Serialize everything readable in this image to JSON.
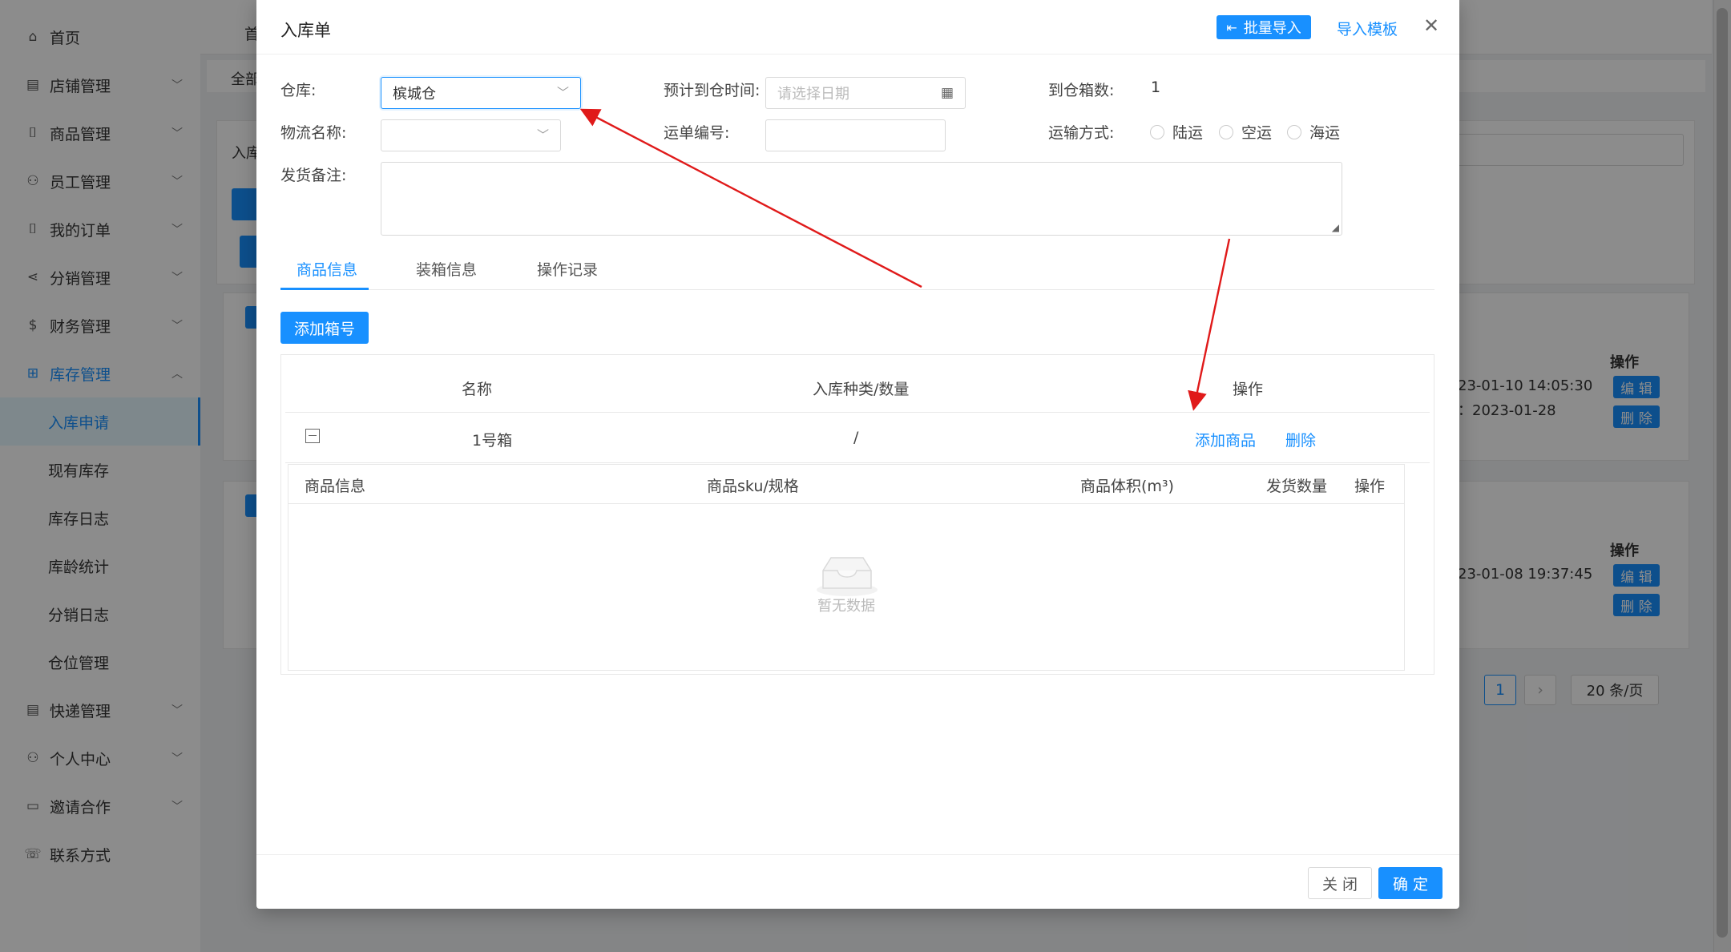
{
  "sidebar": {
    "items": [
      {
        "label": "首页",
        "icon": "home-icon",
        "glyph": "⌂",
        "chevron": false
      },
      {
        "label": "店铺管理",
        "icon": "shop-icon",
        "glyph": "▤",
        "chevron": true
      },
      {
        "label": "商品管理",
        "icon": "bag-icon",
        "glyph": "⌷",
        "chevron": true
      },
      {
        "label": "员工管理",
        "icon": "staff-icon",
        "glyph": "⚇",
        "chevron": true
      },
      {
        "label": "我的订单",
        "icon": "order-icon",
        "glyph": "⌷",
        "chevron": true
      },
      {
        "label": "分销管理",
        "icon": "share-icon",
        "glyph": "⋖",
        "chevron": true
      },
      {
        "label": "财务管理",
        "icon": "finance-icon",
        "glyph": "$",
        "chevron": true
      },
      {
        "label": "库存管理",
        "icon": "grid-icon",
        "glyph": "⊞",
        "chevron": true,
        "expanded": true
      }
    ],
    "sub_items": [
      {
        "label": "入库申请",
        "active": true
      },
      {
        "label": "现有库存"
      },
      {
        "label": "库存日志"
      },
      {
        "label": "库龄统计"
      },
      {
        "label": "分销日志"
      },
      {
        "label": "仓位管理"
      }
    ],
    "items_after": [
      {
        "label": "快递管理",
        "icon": "express-icon",
        "glyph": "▤",
        "chevron": true
      },
      {
        "label": "个人中心",
        "icon": "user-icon",
        "glyph": "⚇",
        "chevron": true
      },
      {
        "label": "邀请合作",
        "icon": "invite-icon",
        "glyph": "▭",
        "chevron": true
      },
      {
        "label": "联系方式",
        "icon": "contact-icon",
        "glyph": "☏",
        "chevron": false
      }
    ]
  },
  "background": {
    "breadcrumb_first": "首",
    "all_tab": "全部",
    "inbound_label": "入库",
    "ops_header_1": "操作",
    "ops_header_2": "操作",
    "edit_label": "编 辑",
    "delete_label": "删 除",
    "row1_time_a": "23-01-10 14:05:30",
    "row1_time_b": "：2023-01-28",
    "row2_time_a": "23-01-08 19:37:45",
    "page_current": "1",
    "page_size": "20 条/页"
  },
  "modal": {
    "title": "入库单",
    "batch_import_label": "批量导入",
    "import_template_label": "导入模板",
    "close_glyph": "✕",
    "form": {
      "warehouse_label": "仓库:",
      "warehouse_value": "槟城仓",
      "eta_label": "预计到仓时间:",
      "eta_placeholder": "请选择日期",
      "box_count_label": "到仓箱数:",
      "box_count_value": "1",
      "logistics_label": "物流名称:",
      "waybill_label": "运单编号:",
      "transport_label": "运输方式:",
      "transport_options": [
        "陆运",
        "空运",
        "海运"
      ],
      "remark_label": "发货备注:"
    },
    "tabs": [
      "商品信息",
      "装箱信息",
      "操作记录"
    ],
    "add_box_label": "添加箱号",
    "box_table": {
      "headers": [
        "名称",
        "入库种类/数量",
        "操作"
      ],
      "row": {
        "name": "1号箱",
        "qty": "/",
        "add_product": "添加商品",
        "delete": "删除"
      },
      "inner_headers": [
        "商品信息",
        "商品sku/规格",
        "商品体积(m³)",
        "发货数量",
        "操作"
      ],
      "empty_text": "暂无数据"
    },
    "footer": {
      "close_label": "关 闭",
      "ok_label": "确 定"
    }
  },
  "colors": {
    "primary": "#1890ff",
    "annotation_arrow": "#e01a1a"
  }
}
